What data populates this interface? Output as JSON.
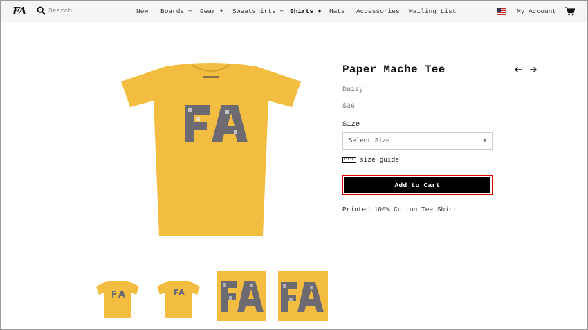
{
  "header": {
    "logo": "FA",
    "search_placeholder": "Search",
    "nav": [
      "New",
      "Boards +",
      "Gear +",
      "Sweatshirts +",
      "Shirts +",
      "Hats",
      "Accessories",
      "Mailing List"
    ],
    "active_nav": "Shirts +",
    "account_label": "My Account"
  },
  "product": {
    "title": "Paper Mache Tee",
    "color": "Daisy",
    "price": "$36",
    "size_label": "Size",
    "size_select_value": "Select Size",
    "size_guide_label": "size guide",
    "add_to_cart_label": "Add to Cart",
    "description": "Printed 100% Cotton Tee Shirt.",
    "shirt_color": "#f2bd40",
    "thumbnail_count": 4
  }
}
